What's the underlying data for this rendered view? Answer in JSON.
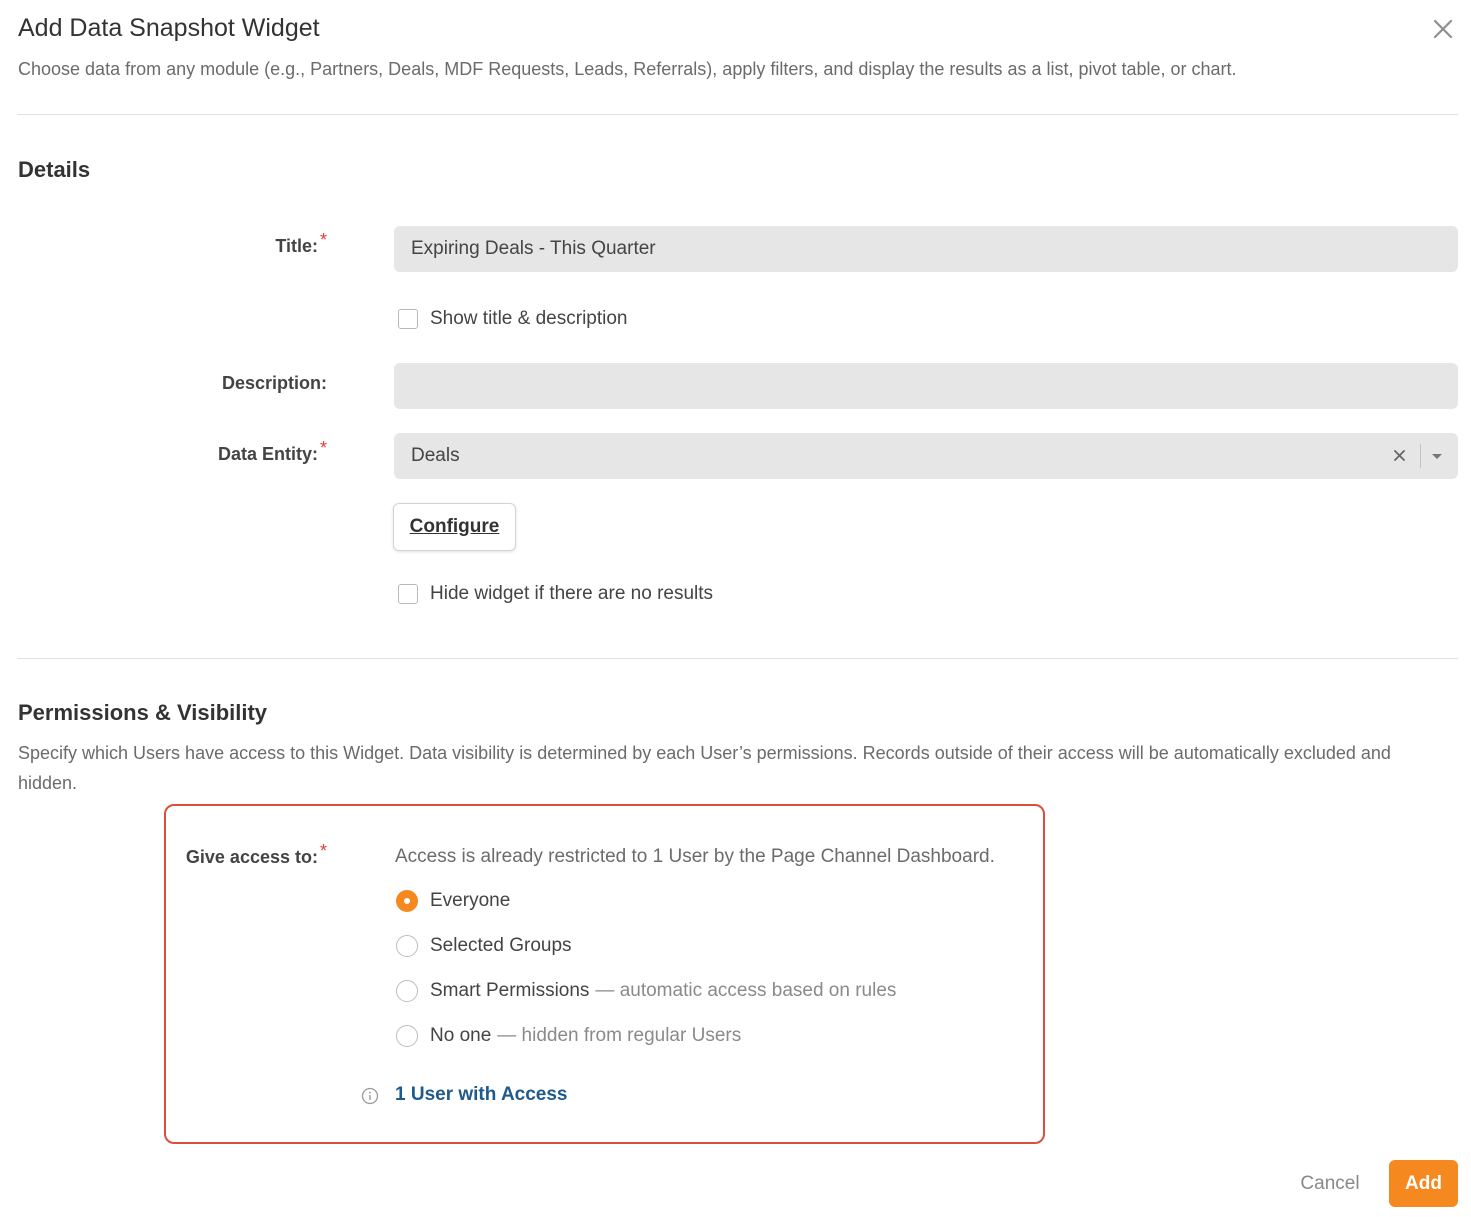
{
  "dialog": {
    "title": "Add Data Snapshot Widget",
    "subtitle": "Choose data from any module (e.g., Partners, Deals, MDF Requests, Leads, Referrals), apply filters, and display the results as a list, pivot table, or chart."
  },
  "details": {
    "heading": "Details",
    "title_label": "Title:",
    "title_value": "Expiring Deals - This Quarter",
    "show_title_label": "Show title & description",
    "description_label": "Description:",
    "description_value": "",
    "data_entity_label": "Data Entity:",
    "data_entity_value": "Deals",
    "configure_label": "Configure",
    "hide_widget_label": "Hide widget if there are no results"
  },
  "permissions": {
    "heading": "Permissions & Visibility",
    "description": "Specify which Users have access to this Widget. Data visibility is determined by each User’s permissions. Records outside of their access will be automatically excluded and hidden.",
    "give_access_label": "Give access to:",
    "access_note": "Access is already restricted to 1 User by the Page Channel Dashboard.",
    "options": [
      {
        "label": "Everyone",
        "hint": "",
        "selected": true
      },
      {
        "label": "Selected Groups",
        "hint": "",
        "selected": false
      },
      {
        "label": "Smart Permissions",
        "hint": "— automatic access based on rules",
        "selected": false
      },
      {
        "label": "No one",
        "hint": "— hidden from regular Users",
        "selected": false
      }
    ],
    "users_link": "1 User with Access"
  },
  "footer": {
    "cancel_label": "Cancel",
    "add_label": "Add"
  },
  "colors": {
    "accent": "#f5891f",
    "highlight_border": "#d9503f",
    "required": "#e53e2f",
    "link": "#1f5a8a"
  }
}
